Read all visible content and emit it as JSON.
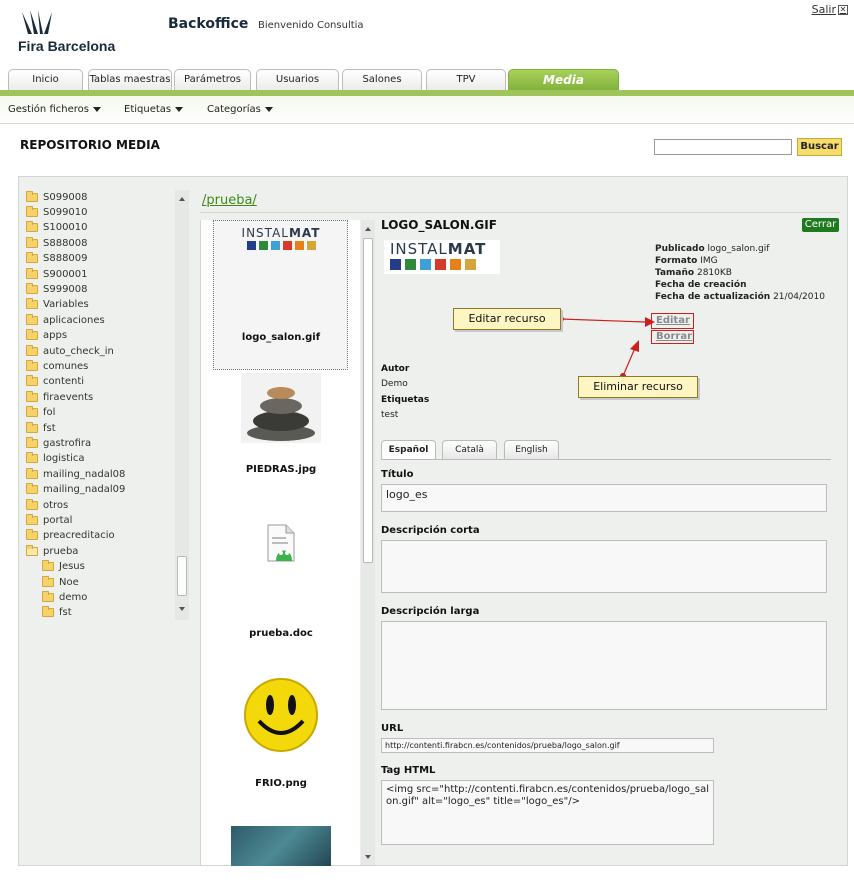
{
  "header": {
    "logo_text": "Fira Barcelona",
    "app_title": "Backoffice",
    "welcome": "Bienvenido Consultia",
    "logout": "Salir"
  },
  "tabs": [
    {
      "label": "Inicio"
    },
    {
      "label": "Tablas maestras"
    },
    {
      "label": "Parámetros"
    },
    {
      "label": "Usuarios"
    },
    {
      "label": "Salones"
    },
    {
      "label": "TPV"
    },
    {
      "label": "Media",
      "active": true
    }
  ],
  "submenu": [
    {
      "label": "Gestión ficheros"
    },
    {
      "label": "Etiquetas"
    },
    {
      "label": "Categorías"
    }
  ],
  "section_title": "REPOSITORIO MEDIA",
  "search": {
    "button": "Buscar",
    "value": ""
  },
  "tree": {
    "items": [
      {
        "label": "S099008"
      },
      {
        "label": "S099010"
      },
      {
        "label": "S100010"
      },
      {
        "label": "S888008"
      },
      {
        "label": "S888009"
      },
      {
        "label": "S900001"
      },
      {
        "label": "S999008"
      },
      {
        "label": "Variables"
      },
      {
        "label": "aplicaciones"
      },
      {
        "label": "apps"
      },
      {
        "label": "auto_check_in"
      },
      {
        "label": "comunes"
      },
      {
        "label": "contenti"
      },
      {
        "label": "firaevents"
      },
      {
        "label": "fol"
      },
      {
        "label": "fst"
      },
      {
        "label": "gastrofira"
      },
      {
        "label": "logistica"
      },
      {
        "label": "mailing_nadal08"
      },
      {
        "label": "mailing_nadal09"
      },
      {
        "label": "otros"
      },
      {
        "label": "portal"
      },
      {
        "label": "preacreditacio"
      },
      {
        "label": "prueba"
      }
    ],
    "children": [
      {
        "label": "Jesus"
      },
      {
        "label": "Noe"
      },
      {
        "label": "demo"
      },
      {
        "label": "fst"
      }
    ]
  },
  "path": "/prueba/",
  "files": [
    {
      "name": "logo_salon.gif",
      "selected": true
    },
    {
      "name": "PIEDRAS.jpg"
    },
    {
      "name": "prueba.doc"
    },
    {
      "name": "FRIO.png"
    }
  ],
  "logo_image": {
    "prefix": "INSTAL",
    "bold": "MAT"
  },
  "detail": {
    "title": "LOGO_SALON.GIF",
    "close": "Cerrar",
    "published_label": "Publicado",
    "published_value": "logo_salon.gif",
    "format_label": "Formato",
    "format_value": "IMG",
    "size_label": "Tamaño",
    "size_value": "2810KB",
    "created_label": "Fecha de creación",
    "updated_label": "Fecha de actualización",
    "updated_value": "21/04/2010",
    "edit": "Editar",
    "delete": "Borrar",
    "callout_edit": "Editar recurso",
    "callout_delete": "Eliminar recurso",
    "author_label": "Autor",
    "author_value": "Demo",
    "tags_label": "Etiquetas",
    "tags_value": "test",
    "lang_tabs": [
      {
        "label": "Español",
        "active": true
      },
      {
        "label": "Català"
      },
      {
        "label": "English"
      }
    ],
    "title_label": "Título",
    "title_value": "logo_es",
    "short_desc_label": "Descripción corta",
    "short_desc_value": "",
    "long_desc_label": "Descripción larga",
    "long_desc_value": "",
    "url_label": "URL",
    "url_value": "http://contenti.firabcn.es/contenidos/prueba/logo_salon.gif",
    "html_label": "Tag HTML",
    "html_value": "<img src=\"http://contenti.firabcn.es/contenidos/prueba/logo_salon.gif\" alt=\"logo_es\" title=\"logo_es\"/>"
  }
}
